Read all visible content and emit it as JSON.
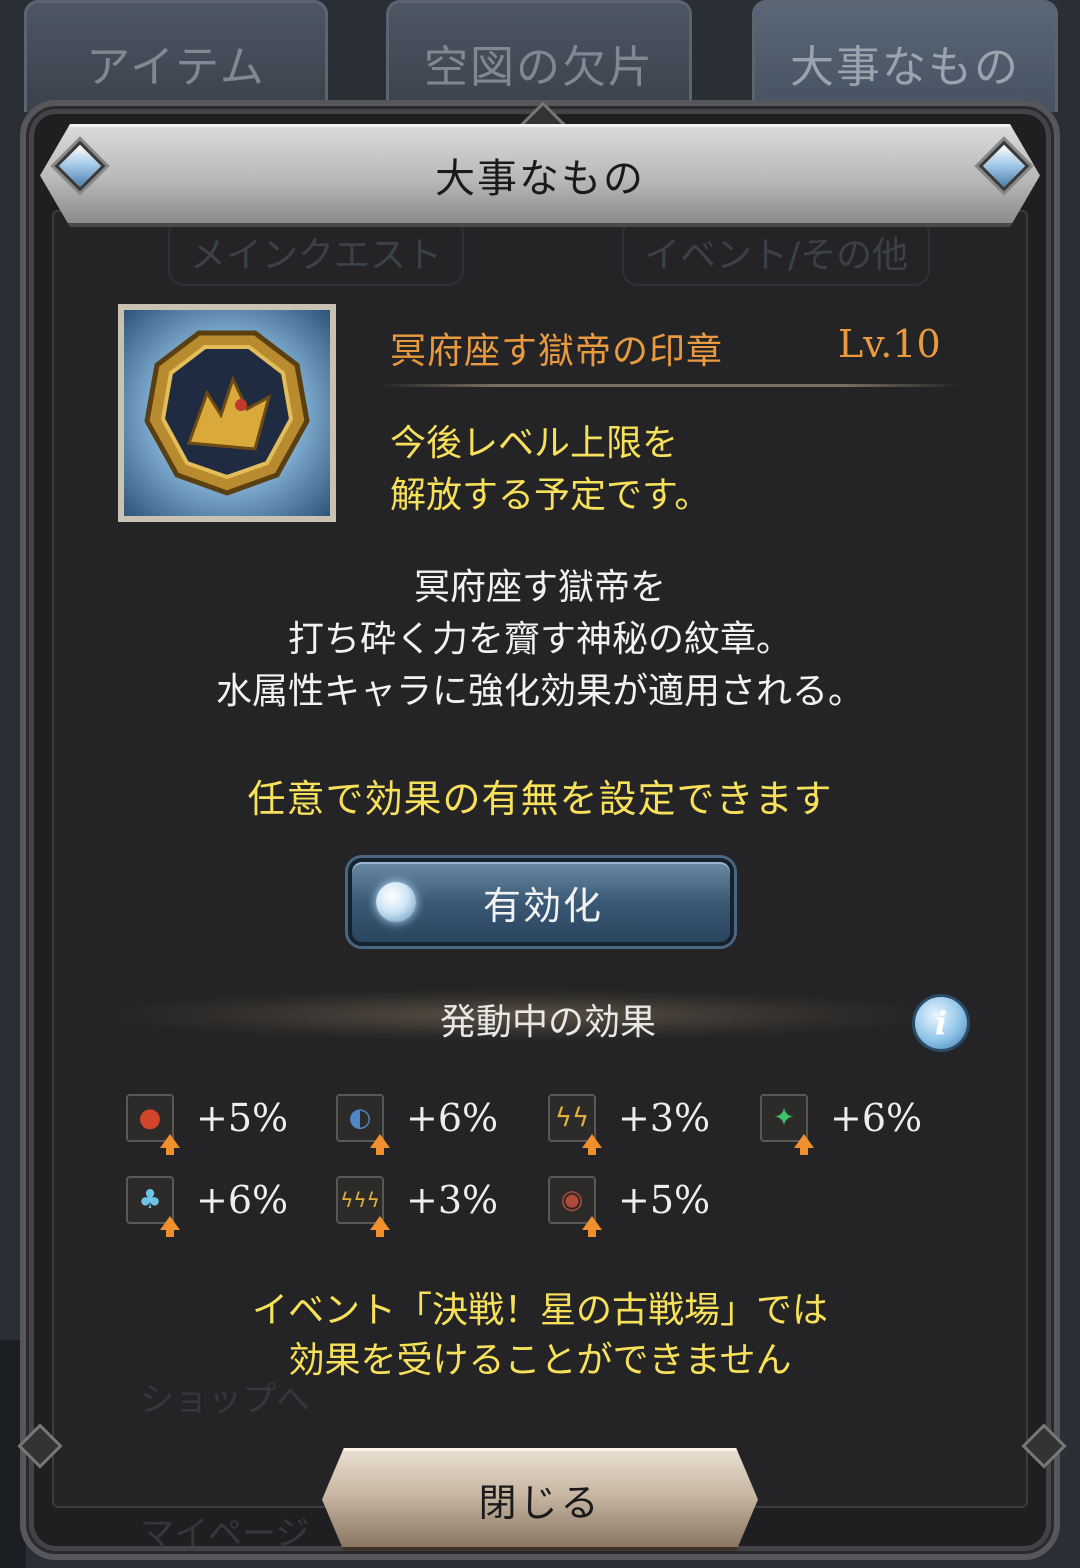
{
  "tabs": [
    {
      "label": "アイテム"
    },
    {
      "label": "空図の欠片"
    },
    {
      "label": "大事なもの"
    }
  ],
  "background": {
    "filters": [
      "メインクエスト",
      "イベント/その他"
    ],
    "shop_link": "ショップへ",
    "mypage_link": "マイページ"
  },
  "modal": {
    "title": "大事なもの",
    "item": {
      "name": "冥府座す獄帝の印章",
      "level": "Lv.10",
      "icon": "seal-medallion-icon",
      "level_note": [
        "今後レベル上限を",
        "解放する予定です。"
      ]
    },
    "description": [
      "冥府座す獄帝を",
      "打ち砕く力を齎す神秘の紋章。",
      "水属性キャラに強化効果が適用される。"
    ],
    "option_note": "任意で効果の有無を設定できます",
    "toggle": {
      "label": "有効化"
    },
    "effects": {
      "title": "発動中の効果",
      "info_icon": "i",
      "items": [
        {
          "icon": "fire-attack-up-icon",
          "value": "+5%",
          "color": "#d2452a"
        },
        {
          "icon": "shield-defense-up-icon",
          "value": "+6%",
          "color": "#4f86c6"
        },
        {
          "icon": "double-attack-up-icon",
          "value": "+3%",
          "color": "#e0b23a"
        },
        {
          "icon": "heal-sparkle-up-icon",
          "value": "+6%",
          "color": "#3fbf6a"
        },
        {
          "icon": "hp-up-icon",
          "value": "+6%",
          "color": "#6ec3e8"
        },
        {
          "icon": "triple-attack-up-icon",
          "value": "+3%",
          "color": "#e0b23a"
        },
        {
          "icon": "debuff-resist-up-icon",
          "value": "+5%",
          "color": "#b24a3a"
        }
      ]
    },
    "event_note": [
      "イベント「決戦！星の古戦場」では",
      "効果を受けることができません"
    ],
    "close": {
      "label": "閉じる"
    }
  }
}
